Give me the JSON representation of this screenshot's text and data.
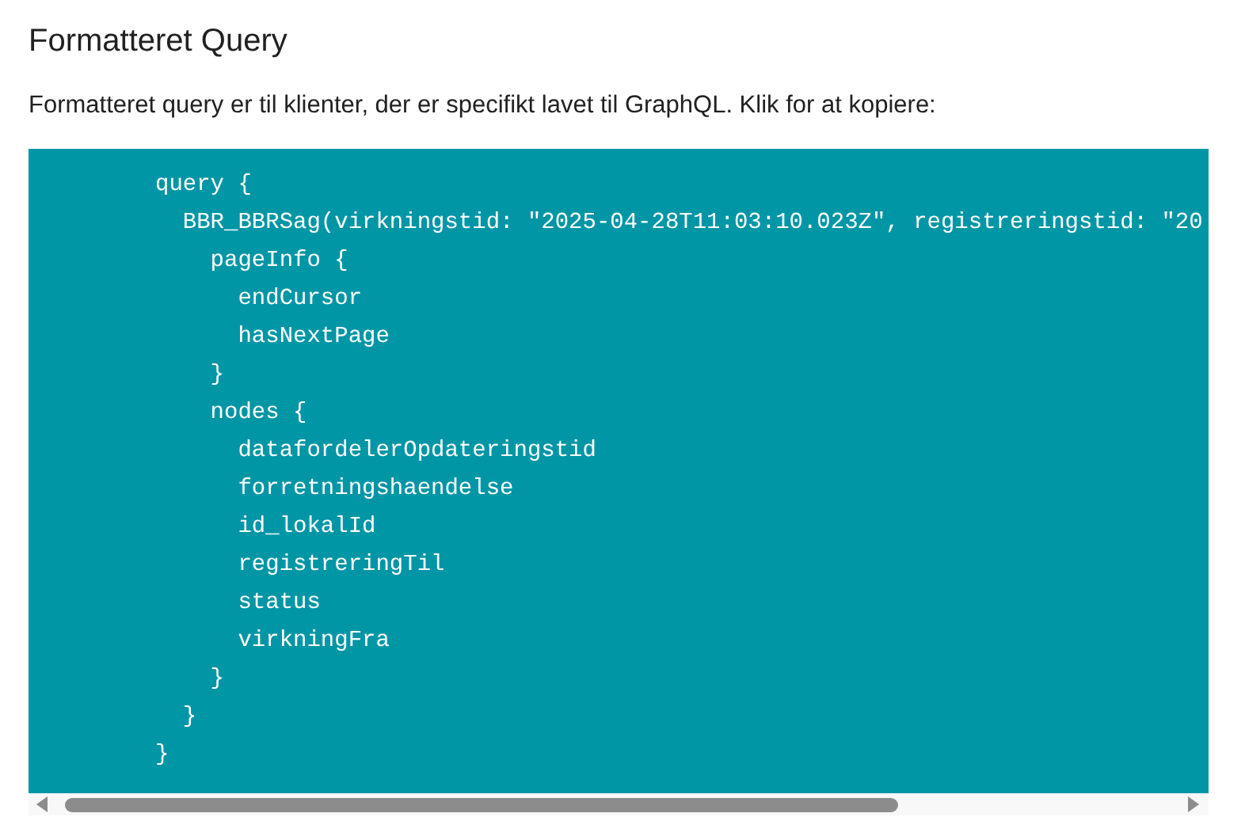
{
  "heading": "Formatteret Query",
  "description": "Formatteret query er til klienter, der er specifikt lavet til GraphQL. Klik for at kopiere:",
  "code_lines": [
    "query {",
    "  BBR_BBRSag(virkningstid: \"2025-04-28T11:03:10.023Z\", registreringstid: \"20",
    "    pageInfo {",
    "      endCursor",
    "      hasNextPage",
    "    }",
    "    nodes {",
    "      datafordelerOpdateringstid",
    "      forretningshaendelse",
    "      id_lokalId",
    "      registreringTil",
    "      status",
    "      virkningFra",
    "    }",
    "  }",
    "}"
  ]
}
